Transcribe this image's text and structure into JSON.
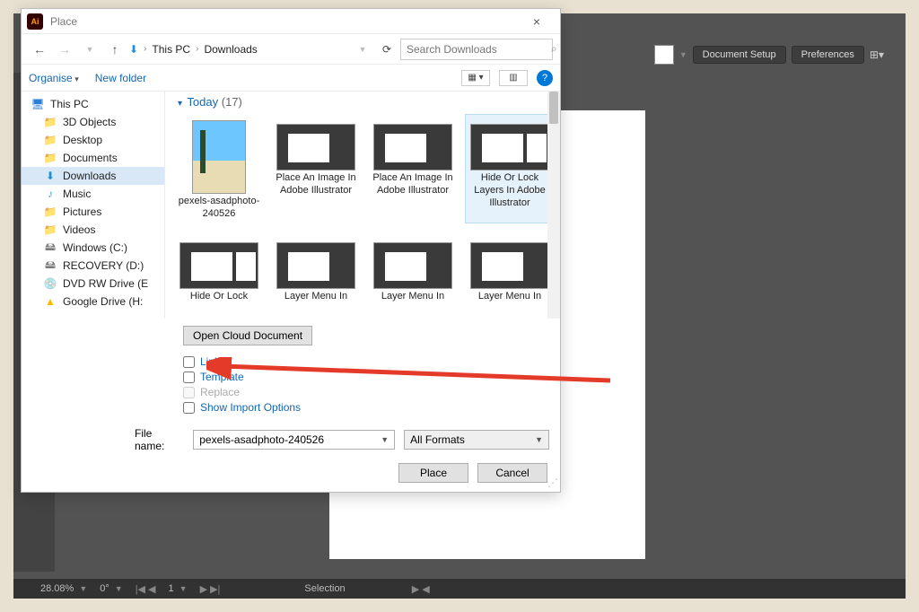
{
  "dialog": {
    "title": "Place",
    "close": "×",
    "breadcrumb": {
      "root": "This PC",
      "folder": "Downloads"
    },
    "search_placeholder": "Search Downloads",
    "organise": "Organise",
    "new_folder": "New folder",
    "group_header": {
      "label": "Today",
      "count": "(17)"
    },
    "open_cloud": "Open Cloud Document",
    "options": {
      "link": "Link",
      "template": "Template",
      "replace": "Replace",
      "show_import": "Show Import Options"
    },
    "filename_label": "File name:",
    "filename_value": "pexels-asadphoto-240526",
    "formats": "All Formats",
    "place_btn": "Place",
    "cancel_btn": "Cancel"
  },
  "sidebar": [
    {
      "icon": "pc",
      "label": "This PC",
      "indent": false
    },
    {
      "icon": "folder",
      "label": "3D Objects",
      "indent": true
    },
    {
      "icon": "folder",
      "label": "Desktop",
      "indent": true
    },
    {
      "icon": "folder",
      "label": "Documents",
      "indent": true
    },
    {
      "icon": "dl",
      "label": "Downloads",
      "indent": true,
      "selected": true
    },
    {
      "icon": "music",
      "label": "Music",
      "indent": true
    },
    {
      "icon": "folder",
      "label": "Pictures",
      "indent": true
    },
    {
      "icon": "folder",
      "label": "Videos",
      "indent": true
    },
    {
      "icon": "drive",
      "label": "Windows (C:)",
      "indent": true
    },
    {
      "icon": "drive",
      "label": "RECOVERY (D:)",
      "indent": true
    },
    {
      "icon": "dvd",
      "label": "DVD RW Drive (E",
      "indent": true
    },
    {
      "icon": "gdrive",
      "label": "Google Drive (H:",
      "indent": true
    }
  ],
  "files": [
    {
      "label": "pexels-asadphoto-240526",
      "thumb": "photo",
      "first": true
    },
    {
      "label": "Place An Image In Adobe Illustrator",
      "thumb": "screenshot"
    },
    {
      "label": "Place An Image In Adobe Illustrator",
      "thumb": "screenshot"
    },
    {
      "label": "Hide Or Lock Layers In Adobe Illustrator",
      "thumb": "screenshot variant2",
      "hover": true
    },
    {
      "label": "Hide Or Lock",
      "thumb": "screenshot variant2"
    },
    {
      "label": "Layer Menu In",
      "thumb": "screenshot"
    },
    {
      "label": "Layer Menu In",
      "thumb": "screenshot"
    },
    {
      "label": "Layer Menu In",
      "thumb": "screenshot"
    }
  ],
  "ai_app": {
    "doc_setup": "Document Setup",
    "prefs": "Preferences",
    "status": {
      "zoom": "28.08%",
      "angle": "0°",
      "page": "1",
      "mode": "Selection"
    }
  }
}
